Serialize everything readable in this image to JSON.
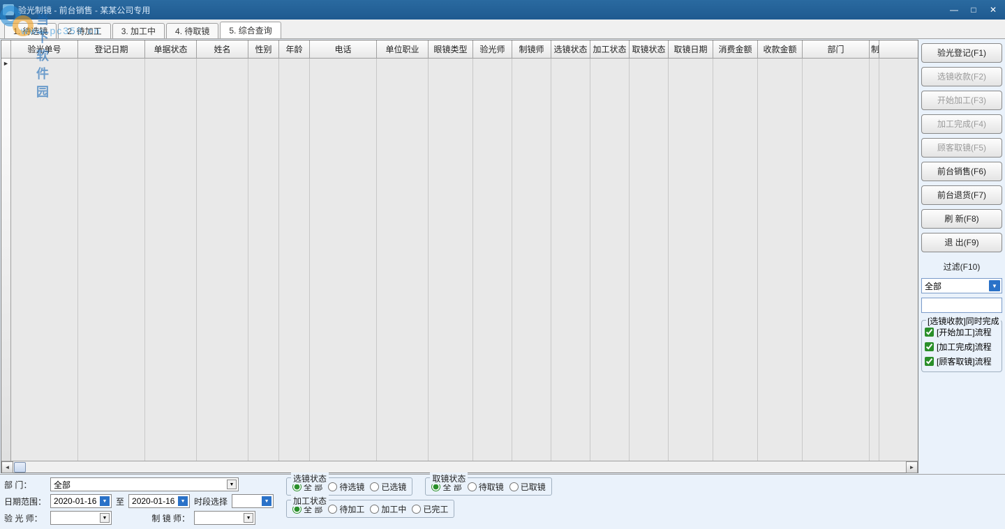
{
  "window": {
    "title": "验光制镜  -  前台销售  -  某某公司专用"
  },
  "watermark": {
    "brand": "当下软件园",
    "url": "www.pc359.cn"
  },
  "tabs": [
    {
      "label": "1. 待选镜"
    },
    {
      "label": "2. 待加工"
    },
    {
      "label": "3. 加工中"
    },
    {
      "label": "4. 待取镜"
    },
    {
      "label": "5. 综合查询"
    }
  ],
  "active_tab": 4,
  "grid": {
    "columns": [
      "验光单号",
      "登记日期",
      "单据状态",
      "姓名",
      "性别",
      "年龄",
      "电话",
      "单位职业",
      "眼镜类型",
      "验光师",
      "制镜师",
      "选镜状态",
      "加工状态",
      "取镜状态",
      "取镜日期",
      "消费金额",
      "收款金额",
      "部门",
      "制"
    ]
  },
  "right": {
    "buttons": [
      {
        "label": "验光登记(F1)",
        "enabled": true
      },
      {
        "label": "选镜收款(F2)",
        "enabled": false
      },
      {
        "label": "开始加工(F3)",
        "enabled": false
      },
      {
        "label": "加工完成(F4)",
        "enabled": false
      },
      {
        "label": "顾客取镜(F5)",
        "enabled": false
      },
      {
        "label": "前台销售(F6)",
        "enabled": true
      },
      {
        "label": "前台退货(F7)",
        "enabled": true
      },
      {
        "label": "刷    新(F8)",
        "enabled": true
      },
      {
        "label": "退    出(F9)",
        "enabled": true
      }
    ],
    "filter_label": "过滤(F10)",
    "filter_value": "全部",
    "group_title": "[选镜收款]同时完成",
    "checks": [
      {
        "label": "[开始加工]流程",
        "checked": true
      },
      {
        "label": "[加工完成]流程",
        "checked": true
      },
      {
        "label": "[顾客取镜]流程",
        "checked": true
      }
    ]
  },
  "bottom": {
    "dept_label": "部    门：",
    "dept_value": "全部",
    "date_label": "日期范围：",
    "date_from": "2020-01-16",
    "date_to_label": "至",
    "date_to": "2020-01-16",
    "period_label": "时段选择",
    "optom_label": "验 光 师：",
    "lensmaker_label": "制 镜 师：",
    "groups": {
      "select": {
        "title": "选镜状态",
        "options": [
          "全  部",
          "待选镜",
          "已选镜"
        ],
        "value": 0
      },
      "process": {
        "title": "加工状态",
        "options": [
          "全  部",
          "待加工",
          "加工中",
          "已完工"
        ],
        "value": 0
      },
      "pickup": {
        "title": "取镜状态",
        "options": [
          "全  部",
          "待取镜",
          "已取镜"
        ],
        "value": 0
      }
    }
  }
}
